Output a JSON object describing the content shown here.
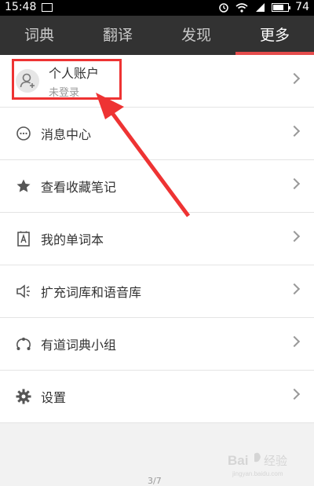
{
  "status_bar": {
    "time": "15:48",
    "battery": "74",
    "battery_level_percent": 74
  },
  "tabs": [
    {
      "label": "词典",
      "active": false
    },
    {
      "label": "翻译",
      "active": false
    },
    {
      "label": "发现",
      "active": false
    },
    {
      "label": "更多",
      "active": true
    }
  ],
  "account": {
    "name": "个人账户",
    "status": "未登录"
  },
  "menu": [
    {
      "label": "消息中心",
      "icon": "message-icon"
    },
    {
      "label": "查看收藏笔记",
      "icon": "star-icon"
    },
    {
      "label": "我的单词本",
      "icon": "wordbook-icon"
    },
    {
      "label": "扩充词库和语音库",
      "icon": "speaker-icon"
    },
    {
      "label": "有道词典小组",
      "icon": "group-icon"
    },
    {
      "label": "设置",
      "icon": "gear-icon"
    }
  ],
  "page_indicator": "3/7",
  "colors": {
    "accent": "#e54c4c",
    "tabbar": "#323232"
  }
}
